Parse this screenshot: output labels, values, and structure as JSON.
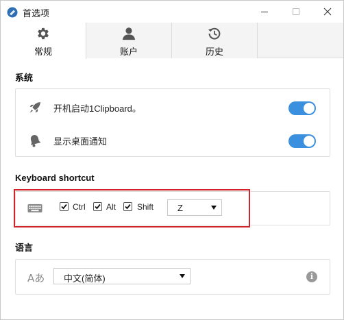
{
  "window": {
    "title": "首选项",
    "controls": {
      "minimize": "minimize",
      "maximize": "maximize",
      "close": "close"
    }
  },
  "tabs": [
    {
      "label": "常规",
      "icon": "gear-icon",
      "active": true
    },
    {
      "label": "账户",
      "icon": "user-icon",
      "active": false
    },
    {
      "label": "历史",
      "icon": "history-icon",
      "active": false
    }
  ],
  "system": {
    "title": "系统",
    "items": [
      {
        "label": "开机启动1Clipboard。",
        "icon": "rocket-icon",
        "enabled": true
      },
      {
        "label": "显示桌面通知",
        "icon": "bell-icon",
        "enabled": true
      }
    ]
  },
  "keyboard": {
    "title": "Keyboard shortcut",
    "icon": "keyboard-icon",
    "modifiers": [
      {
        "label": "Ctrl",
        "checked": true
      },
      {
        "label": "Alt",
        "checked": true
      },
      {
        "label": "Shift",
        "checked": true
      }
    ],
    "key": "Z"
  },
  "language": {
    "title": "语言",
    "icon_text": "Aあ",
    "selected": "中文(简体)",
    "info_icon_glyph": "i"
  },
  "colors": {
    "accent": "#3a8fdf",
    "highlight": "#d2232a"
  }
}
